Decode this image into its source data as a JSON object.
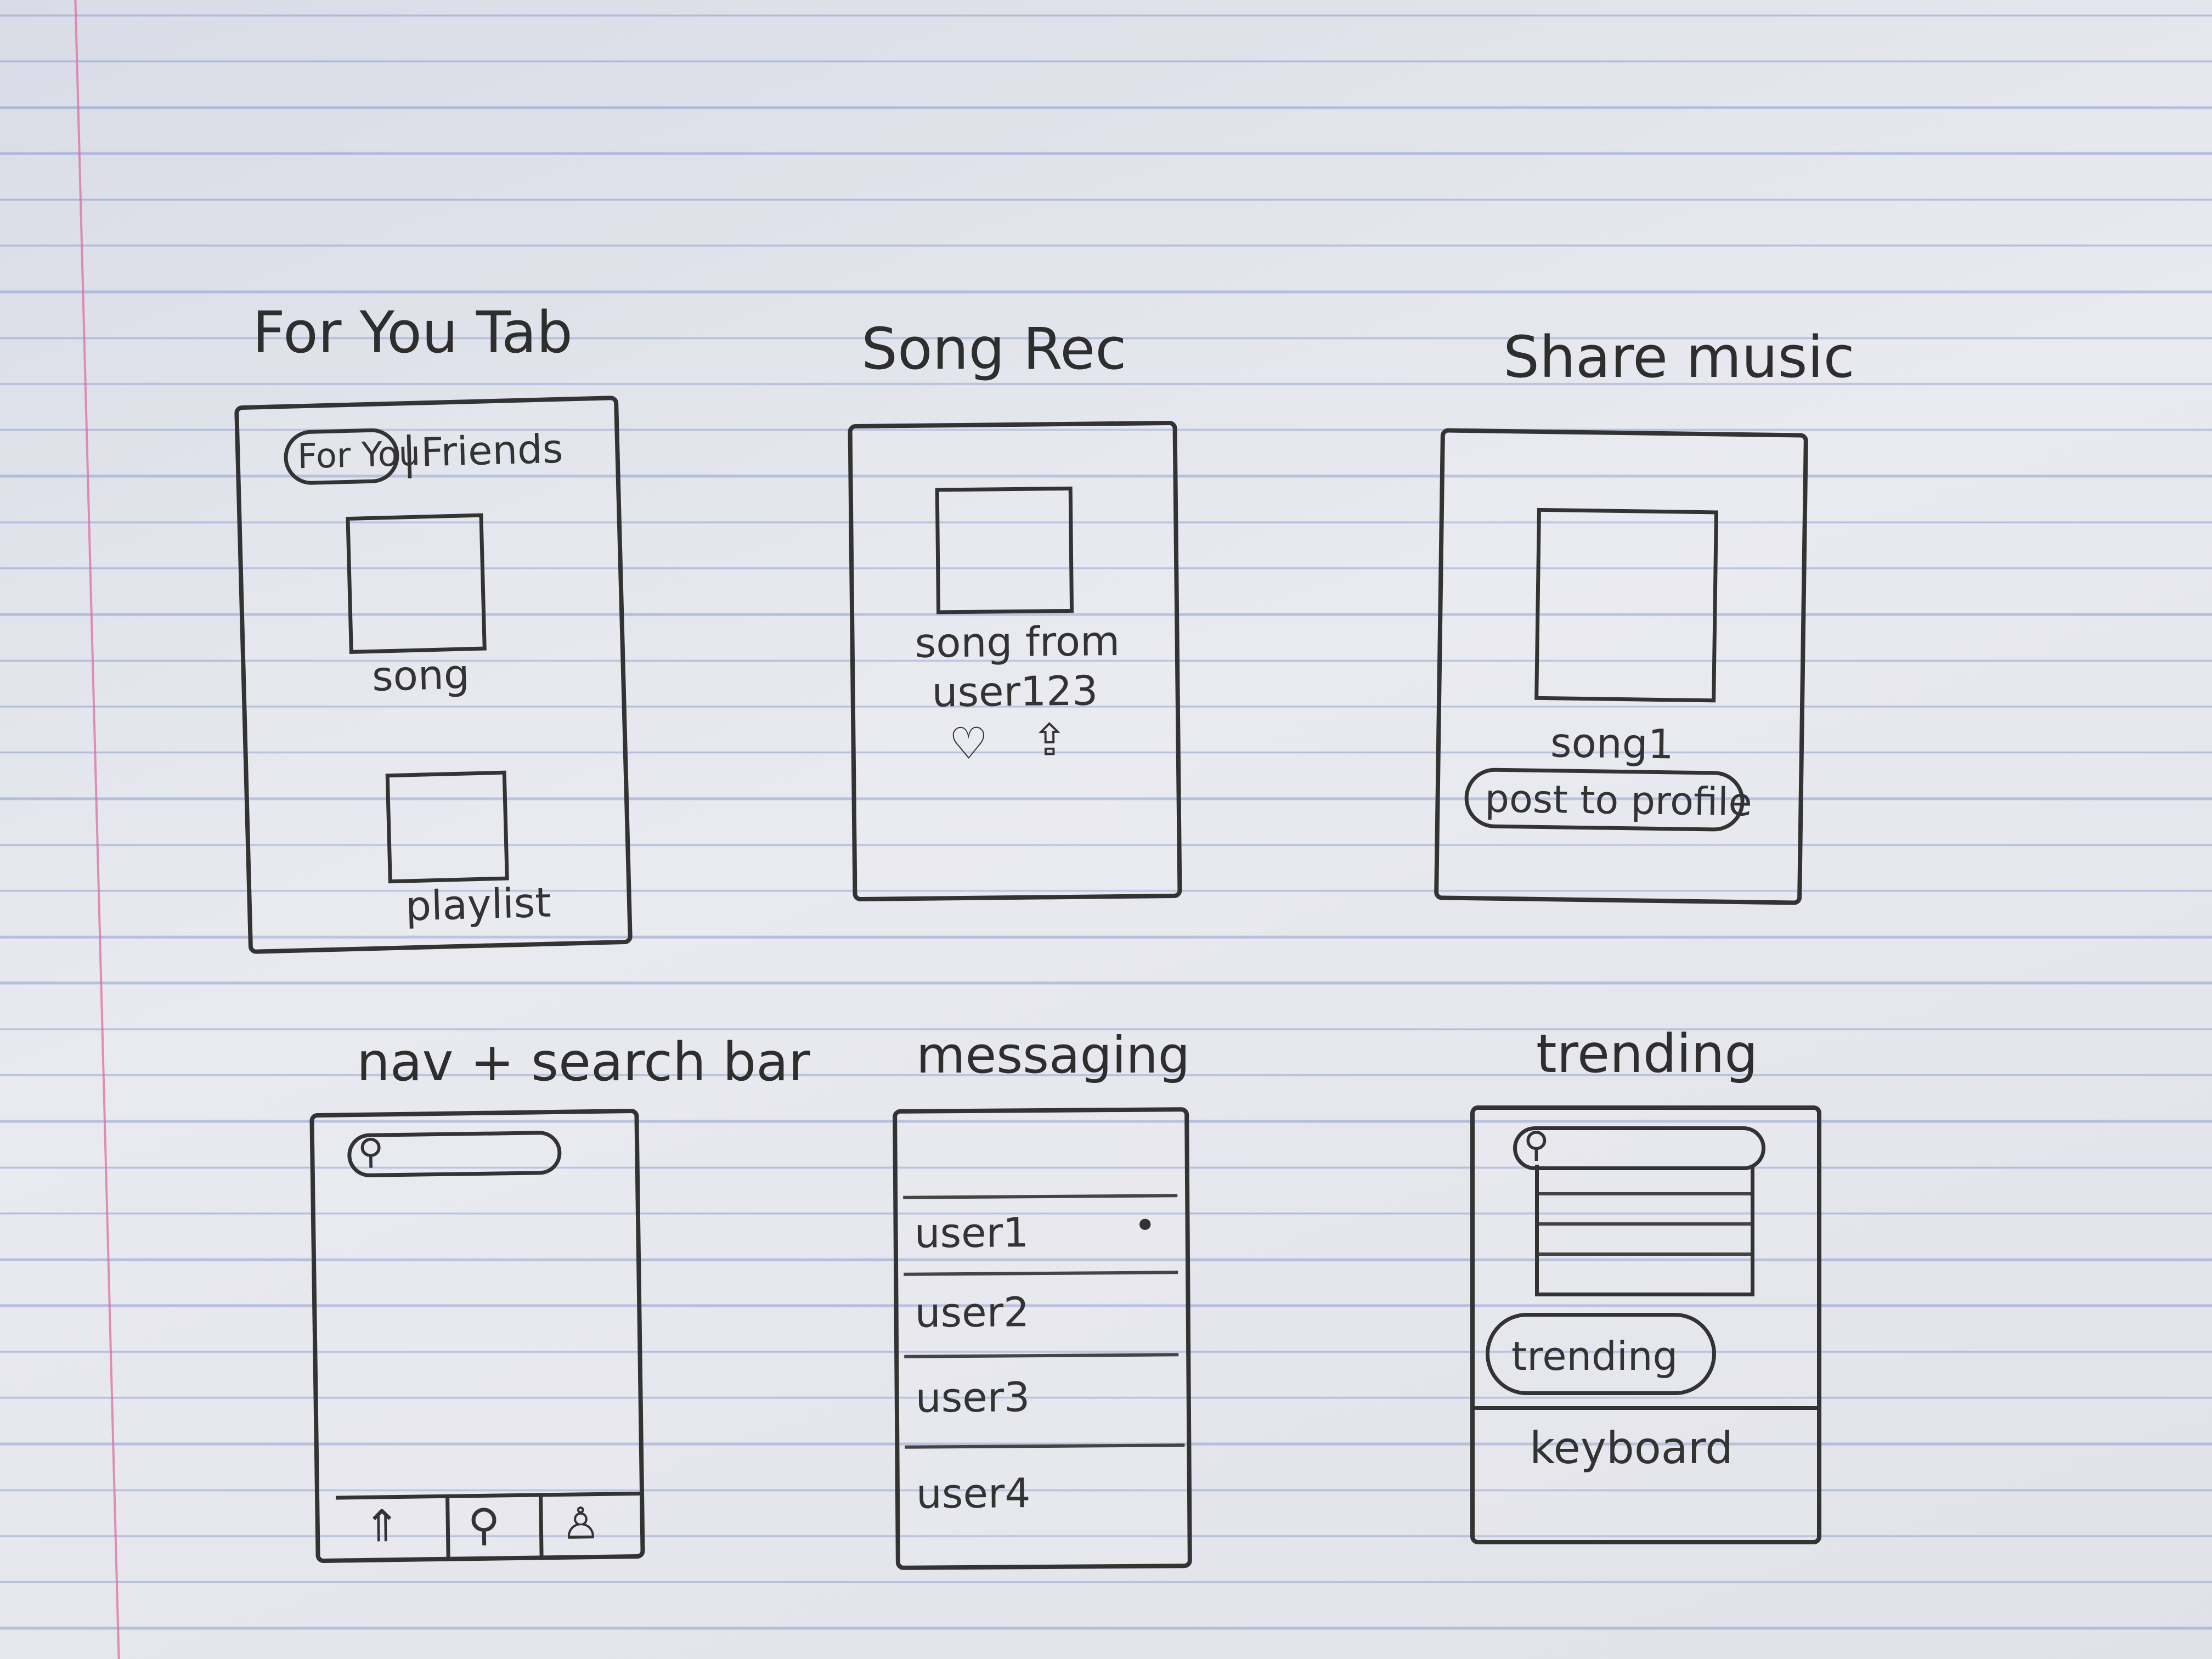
{
  "sketches": {
    "for_you": {
      "title": "For You Tab",
      "tab_for_you": "For You",
      "tab_separator": "|",
      "tab_friends": "Friends",
      "song_label": "song",
      "playlist_label": "playlist"
    },
    "song_rec": {
      "title": "Song Rec",
      "line1": "song from",
      "line2": "user123",
      "like_icon": "♡",
      "share_icon": "⇪"
    },
    "share_music": {
      "title": "Share music",
      "song_label": "song1",
      "post_button": "post to profile"
    },
    "nav_search": {
      "title": "nav + search bar",
      "search_icon": "⚲",
      "nav_home_icon": "⇑",
      "nav_search_icon": "⚲",
      "nav_profile_icon": "♙"
    },
    "messaging": {
      "title": "messaging",
      "users": [
        "user1",
        "user2",
        "user3",
        "user4"
      ],
      "unread_dot": "•"
    },
    "trending": {
      "title": "trending",
      "search_icon": "⚲",
      "trending_button": "trending",
      "keyboard_label": "keyboard"
    }
  }
}
